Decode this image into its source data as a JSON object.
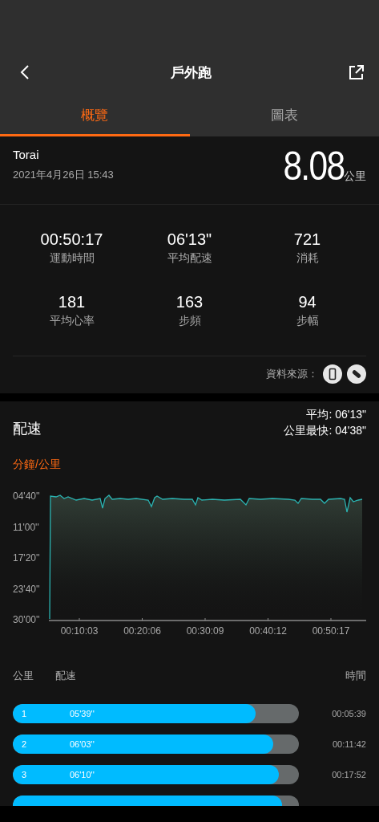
{
  "header": {
    "title": "戶外跑"
  },
  "tabs": [
    {
      "label": "概覽",
      "selected": true
    },
    {
      "label": "圖表",
      "selected": false
    }
  ],
  "summary": {
    "name": "Torai",
    "datetime": "2021年4月26日 15:43",
    "distance": "8.08",
    "distance_unit": "公里"
  },
  "stats": [
    {
      "value": "00:50:17",
      "label": "運動時間"
    },
    {
      "value": "06'13\"",
      "label": "平均配速"
    },
    {
      "value": "721",
      "label": "消耗"
    },
    {
      "value": "181",
      "label": "平均心率"
    },
    {
      "value": "163",
      "label": "步頻"
    },
    {
      "value": "94",
      "label": "步幅"
    }
  ],
  "data_source": {
    "label": "資料來源："
  },
  "pace": {
    "title": "配速",
    "average": "平均: 06'13\"",
    "fastest": "公里最快: 04'38\"",
    "unit": "分鐘/公里",
    "y_labels": [
      "04'40''",
      "11'00''",
      "17'20''",
      "23'40''",
      "30'00''"
    ],
    "x_labels": [
      "00:10:03",
      "00:20:06",
      "00:30:09",
      "00:40:12",
      "00:50:17"
    ]
  },
  "splits": {
    "columns": [
      "公里",
      "配速",
      "時間"
    ],
    "rows": [
      {
        "km": "1",
        "pace": "05'39''",
        "time": "00:05:39",
        "level": 0.85
      },
      {
        "km": "2",
        "pace": "06'03''",
        "time": "00:11:42",
        "level": 0.91
      },
      {
        "km": "3",
        "pace": "06'10''",
        "time": "00:17:52",
        "level": 0.93
      },
      {
        "level": 0.94
      }
    ]
  }
}
